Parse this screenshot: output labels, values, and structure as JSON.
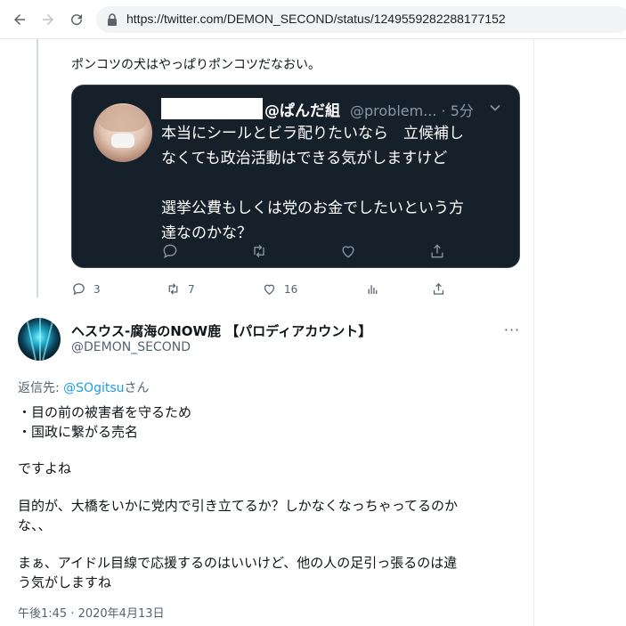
{
  "browser": {
    "url": "https://twitter.com/DEMON_SECOND/status/1249559282288177152"
  },
  "top_tweet": {
    "text": "ポンコツの犬はやっぱりポンコツだなおい。",
    "quote": {
      "name": "@ぱんだ組",
      "handle_time": "@problem... · 5分",
      "body": [
        "本当にシールとビラ配りたいなら　立候補し",
        "なくても政治活動はできる気がしますけど",
        "",
        "選挙公費もしくは党のお金でしたいという方",
        "達なのかな？"
      ]
    },
    "counts": {
      "replies": "3",
      "retweets": "7",
      "likes": "16"
    }
  },
  "main_tweet": {
    "display_name": "ヘスウス-腐海のNOW鹿 【パロディアカウント】",
    "screen_name": "@DEMON_SECOND",
    "more_icon": "···",
    "reply_prefix": "返信先: ",
    "reply_mention": "@SOgitsu",
    "reply_suffix": "さん",
    "lines": [
      "・目の前の被害者を守るため",
      "・国政に繋がる売名",
      "ですよね",
      "目的が、大橋をいかに党内で引き立てるか？しかなくなっちゃってるのか",
      "な、、",
      "まぁ、アイドル目線で応援するのはいいけど、他の人の足引っ張るのは違",
      "う気がしますね"
    ],
    "timestamp": "午後1:45 · 2020年4月13日"
  },
  "colors": {
    "link": "#1d9bf0",
    "dim_card": "#15202b",
    "secondary_text": "#536471"
  }
}
